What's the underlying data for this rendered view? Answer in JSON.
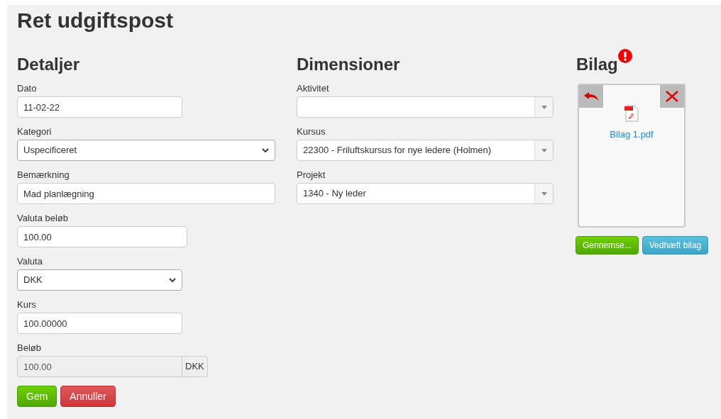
{
  "page_title": "Ret udgiftspost",
  "details": {
    "heading": "Detaljer",
    "fields": [
      {
        "kind": "input",
        "label": "Dato",
        "value": "11-02-22"
      },
      {
        "kind": "select",
        "label": "Kategori",
        "value": "Uspecificeret"
      },
      {
        "kind": "input",
        "label": "Bemærkning",
        "value": "Mad planlægning"
      },
      {
        "kind": "input",
        "label": "Valuta beløb",
        "value": "100.00"
      },
      {
        "kind": "select",
        "label": "Valuta",
        "value": "DKK"
      },
      {
        "kind": "input",
        "label": "Kurs",
        "value": "100.00000"
      },
      {
        "kind": "readonly",
        "label": "Beløb",
        "value": "100.00",
        "addon": "DKK"
      }
    ]
  },
  "dimensions": {
    "heading": "Dimensioner",
    "fields": [
      {
        "kind": "combo",
        "label": "Aktivitet"
      },
      {
        "kind": "combo",
        "label": "Kursus",
        "value": "22300 - Friluftskursus for nye ledere (Holmen)"
      },
      {
        "kind": "combo",
        "label": "Projekt",
        "value": "1340 - Ny leder"
      }
    ]
  },
  "attachments": {
    "heading": "Bilag",
    "warning": true,
    "file": {
      "name": "Bilag 1.pdf"
    },
    "buttons": [
      {
        "kind": "browse",
        "label": "Gennemse..."
      },
      {
        "kind": "attach",
        "label": "Vedhæft bilag"
      }
    ]
  },
  "actions": [
    {
      "kind": "save",
      "label": "Gem"
    },
    {
      "kind": "cancel",
      "label": "Annuller"
    }
  ]
}
